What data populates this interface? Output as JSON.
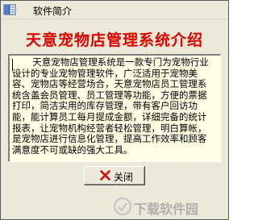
{
  "window": {
    "title": "软件简介"
  },
  "heading": "天意宠物店管理系统介绍",
  "description": "天意宠物店管理系统是一款专门为宠物行业设计的专业宠物管理软件，广泛适用于宠物美容、宠物店等经营场合，天意宠物店员工管理系统含盖会员管理、员工管理等功能，方便的票据打印，简洁实用的库存管理，带有客户回访功能，能计算员工每月提成金额，详细完备的统计报表，让宠物机构经营者轻松管理，明白算帐，是宠物店进行信息化管理，提高工作效率和顾客满意度不可或缺的强大工具。",
  "buttons": {
    "close_label": "关闭"
  },
  "watermark": {
    "text": "下载软件园"
  },
  "colors": {
    "heading": "#e00000",
    "textbox_bg": "#ffffe6",
    "dialog_bg": "#ece9d8"
  }
}
